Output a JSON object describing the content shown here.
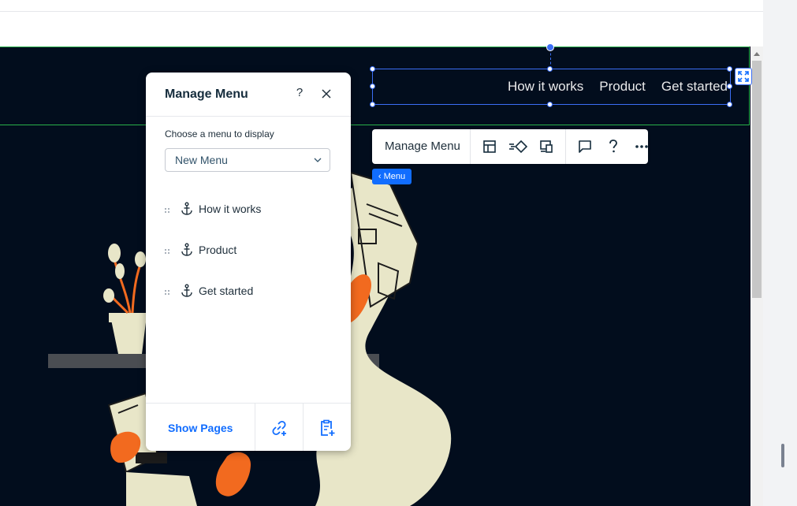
{
  "site_header": {
    "nav_items": [
      "How it works",
      "Product",
      "Get started"
    ]
  },
  "toolbar": {
    "manage_label": "Manage Menu",
    "buttons": [
      "layout-icon",
      "animation-icon",
      "devices-icon",
      "comment-icon",
      "help-icon",
      "more-icon"
    ]
  },
  "breadcrumb_tag": "Menu",
  "panel": {
    "title": "Manage Menu",
    "help_label": "?",
    "choose_label": "Choose a menu to display",
    "selected_menu": "New Menu",
    "items": [
      {
        "label": "How it works",
        "icon": "anchor-icon"
      },
      {
        "label": "Product",
        "icon": "anchor-icon"
      },
      {
        "label": "Get started",
        "icon": "anchor-icon"
      }
    ],
    "footer": {
      "show_pages_label": "Show Pages"
    }
  },
  "colors": {
    "canvas_bg": "#020d1d",
    "accent_blue": "#116dff",
    "selection_green": "#28b04a",
    "illustration_cream": "#e8e6c8",
    "illustration_orange": "#f26a1f"
  }
}
